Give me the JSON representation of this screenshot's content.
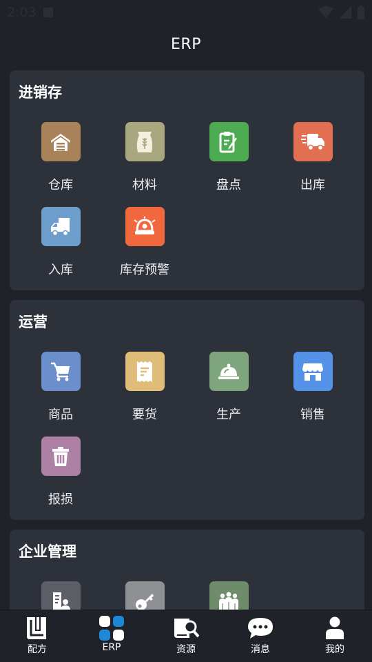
{
  "status_bar": {
    "time": "2:03"
  },
  "app_title": "ERP",
  "sections": [
    {
      "title": "进销存",
      "items": [
        {
          "label": "仓库",
          "icon": "warehouse-icon",
          "color": "#a8835a"
        },
        {
          "label": "材料",
          "icon": "material-bag-icon",
          "color": "#a8a77e"
        },
        {
          "label": "盘点",
          "icon": "clipboard-edit-icon",
          "color": "#4dab52"
        },
        {
          "label": "出库",
          "icon": "truck-out-icon",
          "color": "#e36f52"
        },
        {
          "label": "入库",
          "icon": "truck-in-icon",
          "color": "#6e9ecb"
        },
        {
          "label": "库存预警",
          "icon": "alarm-bell-icon",
          "color": "#f2683e"
        }
      ]
    },
    {
      "title": "运营",
      "items": [
        {
          "label": "商品",
          "icon": "cart-icon",
          "color": "#6a8fca"
        },
        {
          "label": "要货",
          "icon": "receipt-icon",
          "color": "#dfbd79"
        },
        {
          "label": "生产",
          "icon": "cloche-icon",
          "color": "#7fa57c"
        },
        {
          "label": "销售",
          "icon": "storefront-icon",
          "color": "#5492e8"
        },
        {
          "label": "报损",
          "icon": "trash-icon",
          "color": "#ad80a5"
        }
      ]
    },
    {
      "title": "企业管理",
      "items": [
        {
          "label": "",
          "icon": "building-person-icon",
          "color": "#5c5f66"
        },
        {
          "label": "",
          "icon": "key-icon",
          "color": "#8f9094"
        },
        {
          "label": "",
          "icon": "people-group-icon",
          "color": "#6f8c6a"
        }
      ]
    }
  ],
  "tabs": [
    {
      "label": "配方",
      "icon": "book-icon"
    },
    {
      "label": "ERP",
      "icon": "grid-icon",
      "active": true
    },
    {
      "label": "资源",
      "icon": "book-search-icon"
    },
    {
      "label": "消息",
      "icon": "chat-bubble-icon"
    },
    {
      "label": "我的",
      "icon": "person-icon"
    }
  ]
}
